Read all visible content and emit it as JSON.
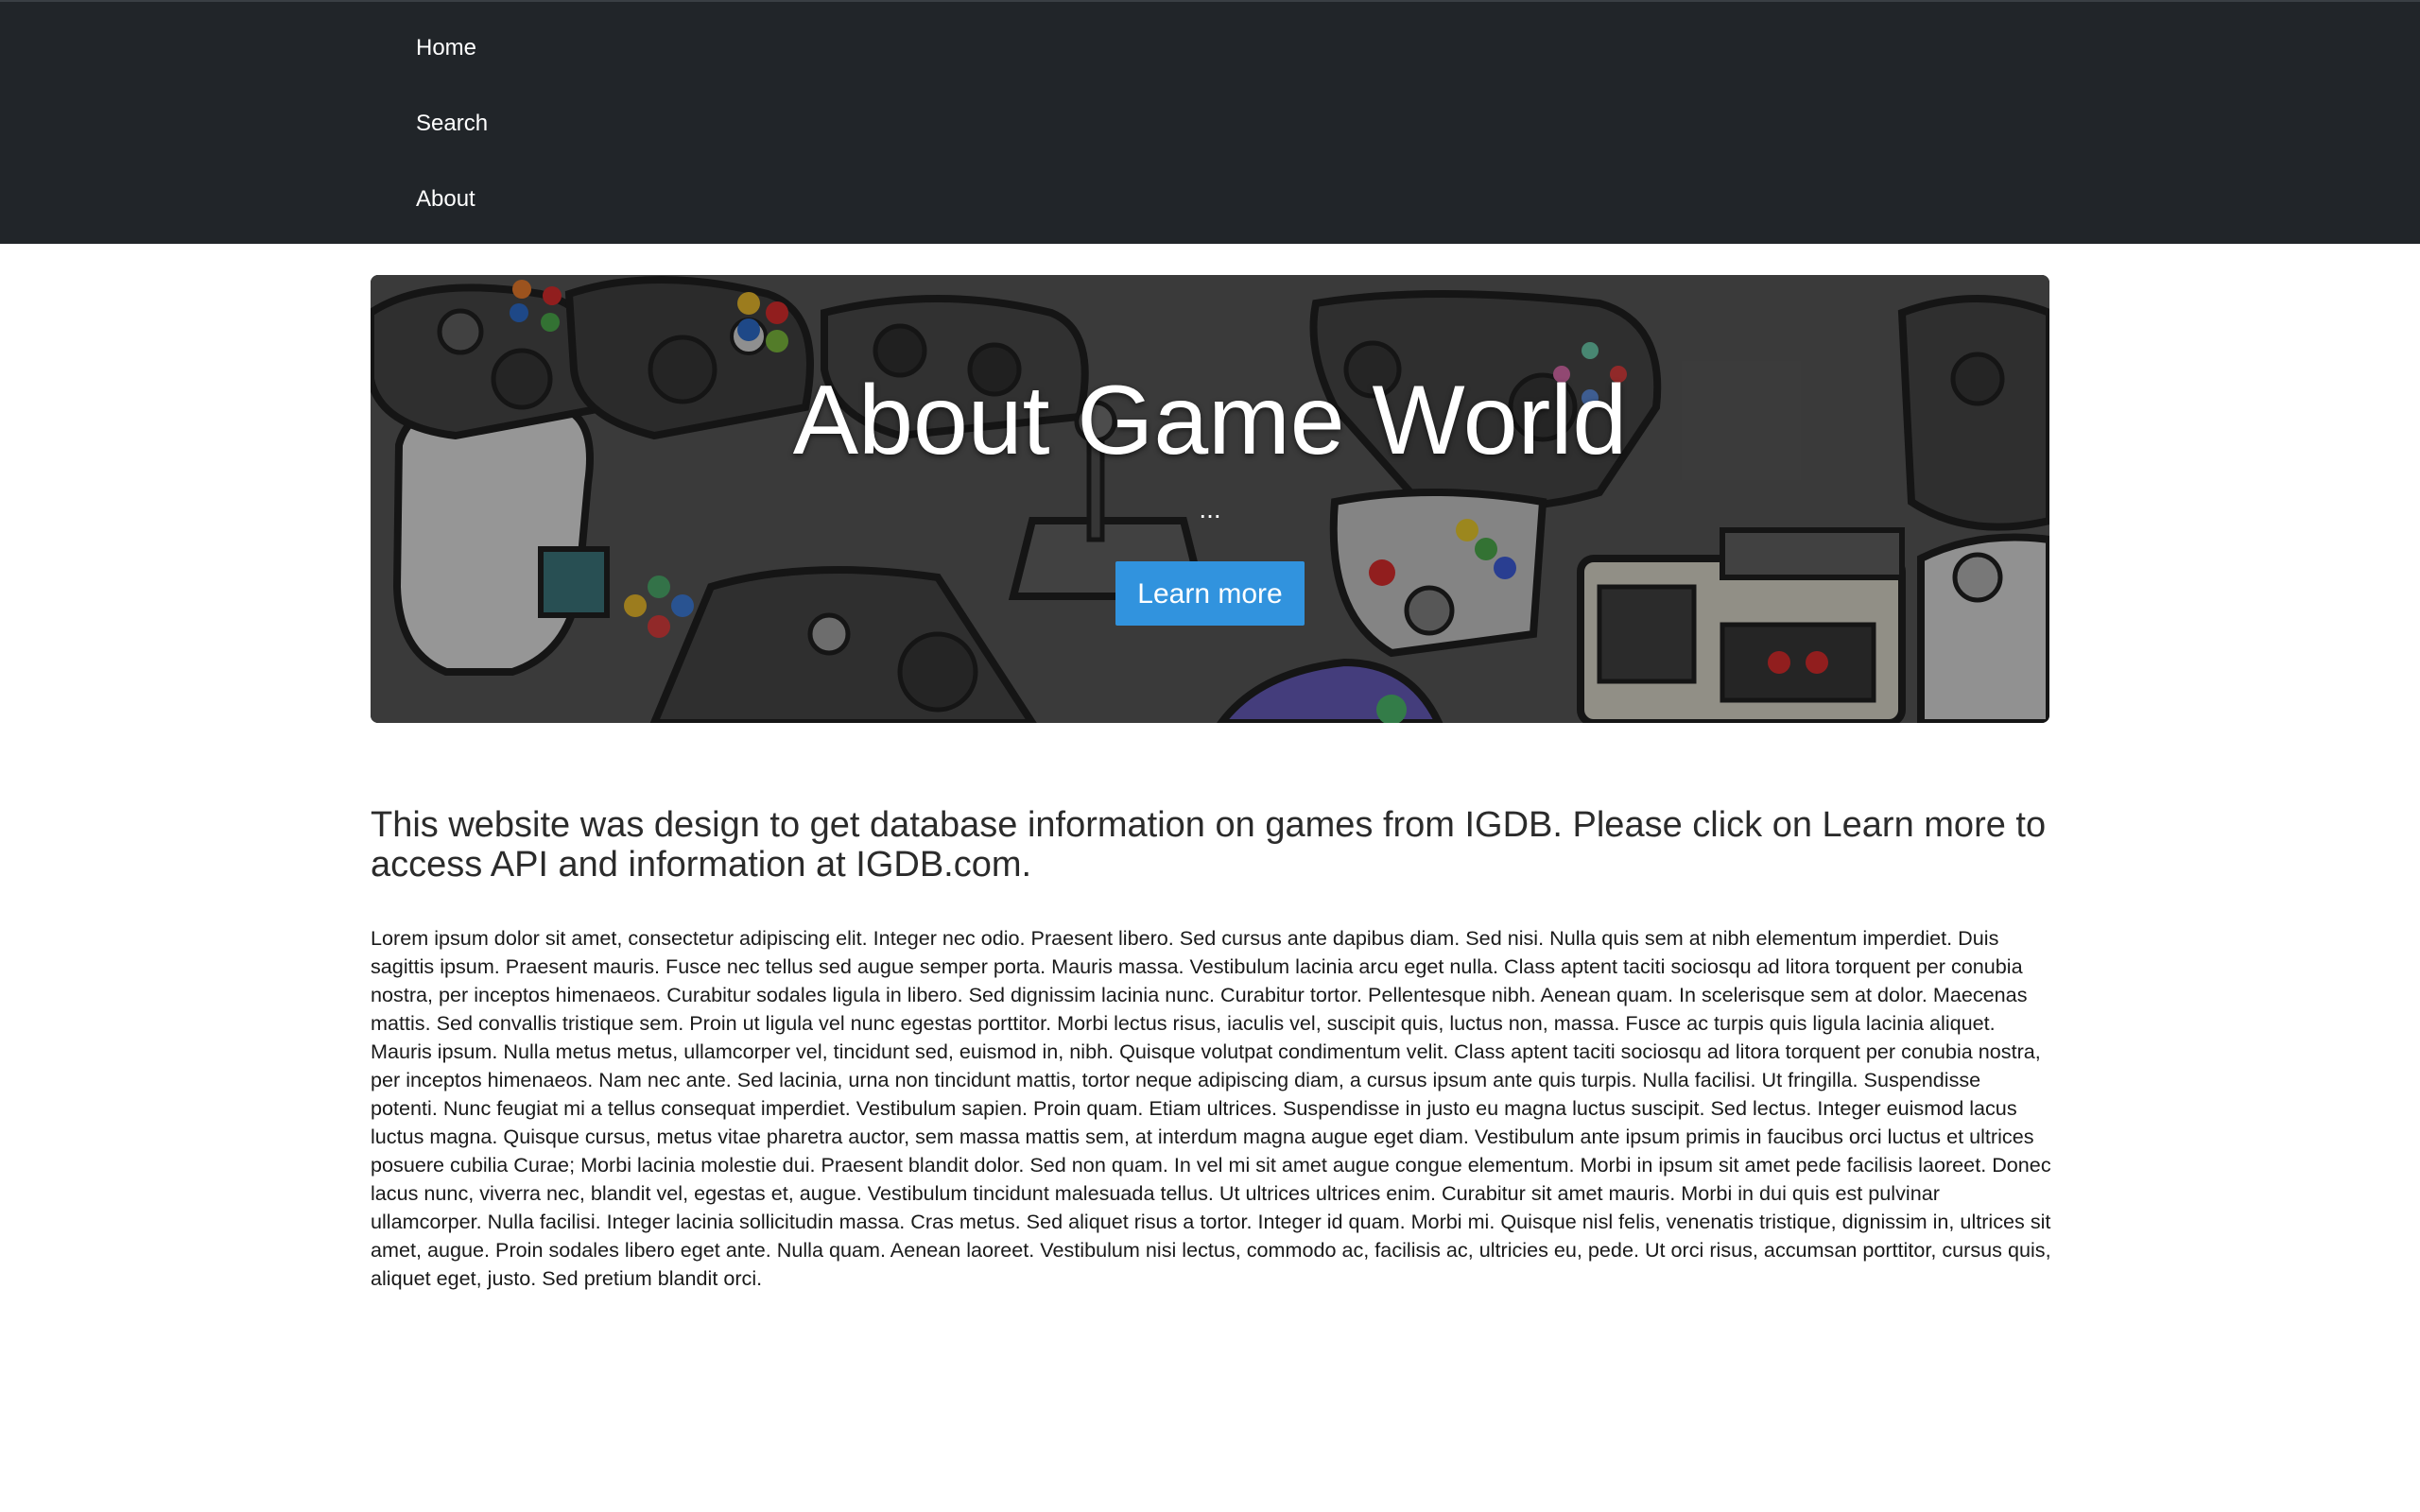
{
  "nav": {
    "items": [
      {
        "label": "Home"
      },
      {
        "label": "Search"
      },
      {
        "label": "About"
      }
    ]
  },
  "hero": {
    "title": "About Game World",
    "subtitle": "...",
    "button_label": "Learn more",
    "button_color": "#3193de",
    "background_image": "game-controllers-collage"
  },
  "content": {
    "lead": "This website was design to get database information on games from IGDB. Please click on Learn more to access API and information at IGDB.com.",
    "body": "Lorem ipsum dolor sit amet, consectetur adipiscing elit. Integer nec odio. Praesent libero. Sed cursus ante dapibus diam. Sed nisi. Nulla quis sem at nibh elementum imperdiet. Duis sagittis ipsum. Praesent mauris. Fusce nec tellus sed augue semper porta. Mauris massa. Vestibulum lacinia arcu eget nulla. Class aptent taciti sociosqu ad litora torquent per conubia nostra, per inceptos himenaeos. Curabitur sodales ligula in libero. Sed dignissim lacinia nunc. Curabitur tortor. Pellentesque nibh. Aenean quam. In scelerisque sem at dolor. Maecenas mattis. Sed convallis tristique sem. Proin ut ligula vel nunc egestas porttitor. Morbi lectus risus, iaculis vel, suscipit quis, luctus non, massa. Fusce ac turpis quis ligula lacinia aliquet. Mauris ipsum. Nulla metus metus, ullamcorper vel, tincidunt sed, euismod in, nibh. Quisque volutpat condimentum velit. Class aptent taciti sociosqu ad litora torquent per conubia nostra, per inceptos himenaeos. Nam nec ante. Sed lacinia, urna non tincidunt mattis, tortor neque adipiscing diam, a cursus ipsum ante quis turpis. Nulla facilisi. Ut fringilla. Suspendisse potenti. Nunc feugiat mi a tellus consequat imperdiet. Vestibulum sapien. Proin quam. Etiam ultrices. Suspendisse in justo eu magna luctus suscipit. Sed lectus. Integer euismod lacus luctus magna. Quisque cursus, metus vitae pharetra auctor, sem massa mattis sem, at interdum magna augue eget diam. Vestibulum ante ipsum primis in faucibus orci luctus et ultrices posuere cubilia Curae; Morbi lacinia molestie dui. Praesent blandit dolor. Sed non quam. In vel mi sit amet augue congue elementum. Morbi in ipsum sit amet pede facilisis laoreet. Donec lacus nunc, viverra nec, blandit vel, egestas et, augue. Vestibulum tincidunt malesuada tellus. Ut ultrices ultrices enim. Curabitur sit amet mauris. Morbi in dui quis est pulvinar ullamcorper. Nulla facilisi. Integer lacinia sollicitudin massa. Cras metus. Sed aliquet risus a tortor. Integer id quam. Morbi mi. Quisque nisl felis, venenatis tristique, dignissim in, ultrices sit amet, augue. Proin sodales libero eget ante. Nulla quam. Aenean laoreet. Vestibulum nisi lectus, commodo ac, facilisis ac, ultricies eu, pede. Ut orci risus, accumsan porttitor, cursus quis, aliquet eget, justo. Sed pretium blandit orci."
  },
  "colors": {
    "navbar_bg": "#212529",
    "page_bg": "#ffffff"
  }
}
